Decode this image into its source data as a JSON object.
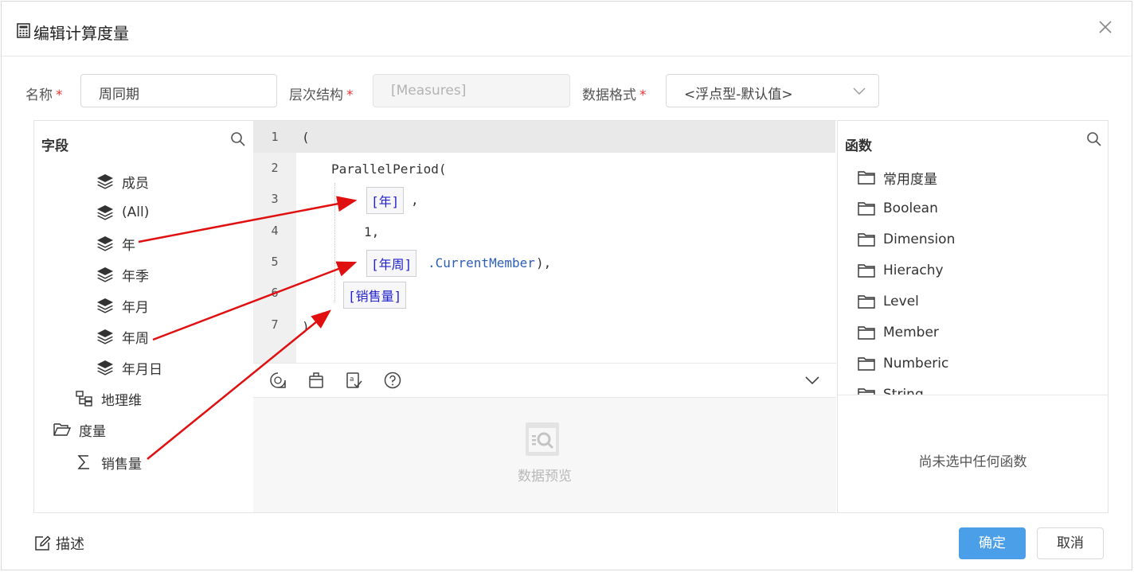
{
  "dialog": {
    "title": "编辑计算度量",
    "close_label": "×"
  },
  "form": {
    "name_label": "名称",
    "name_value": "周同期",
    "hierarchy_label": "层次结构",
    "hierarchy_value": "[Measures]",
    "format_label": "数据格式",
    "format_value": "<浮点型-默认值>",
    "required_mark": "*"
  },
  "fields_panel": {
    "title": "字段",
    "items": [
      {
        "label": "成员",
        "icon": "layers-icon"
      },
      {
        "label": "(All)",
        "icon": "layers-icon"
      },
      {
        "label": "年",
        "icon": "layers-icon"
      },
      {
        "label": "年季",
        "icon": "layers-icon"
      },
      {
        "label": "年月",
        "icon": "layers-icon"
      },
      {
        "label": "年周",
        "icon": "layers-icon"
      },
      {
        "label": "年月日",
        "icon": "layers-icon"
      },
      {
        "label": "地理维",
        "icon": "hierarchy-icon"
      },
      {
        "label": "度量",
        "icon": "folder-open-icon"
      },
      {
        "label": "销售量",
        "icon": "sigma-icon"
      }
    ]
  },
  "editor": {
    "line_numbers": [
      "1",
      "2",
      "3",
      "4",
      "5",
      "6",
      "7"
    ],
    "lines": {
      "l1": "(",
      "l2": "ParallelPeriod(",
      "l3_token": "[年]",
      "l3_rest": ",",
      "l4": "1,",
      "l5_token": "[年周]",
      "l5_member": ".CurrentMember",
      "l5_rest": "),",
      "l6_token": "[销售量]",
      "l7": ")"
    }
  },
  "toolbar": {
    "buttons": [
      "format-icon",
      "clipboard-icon",
      "check-syntax-icon",
      "help-icon"
    ],
    "collapse_icon": "chevron-down-icon"
  },
  "preview": {
    "label": "数据预览"
  },
  "functions_panel": {
    "title": "函数",
    "items": [
      "常用度量",
      "Boolean",
      "Dimension",
      "Hierachy",
      "Level",
      "Member",
      "Numberic",
      "String"
    ],
    "empty_text": "尚未选中任何函数"
  },
  "footer": {
    "describe_label": "描述",
    "ok_label": "确定",
    "cancel_label": "取消"
  },
  "colors": {
    "primary": "#4a9fe8",
    "required": "#ee3333",
    "token": "#2222cc",
    "arrow": "#e01010"
  }
}
